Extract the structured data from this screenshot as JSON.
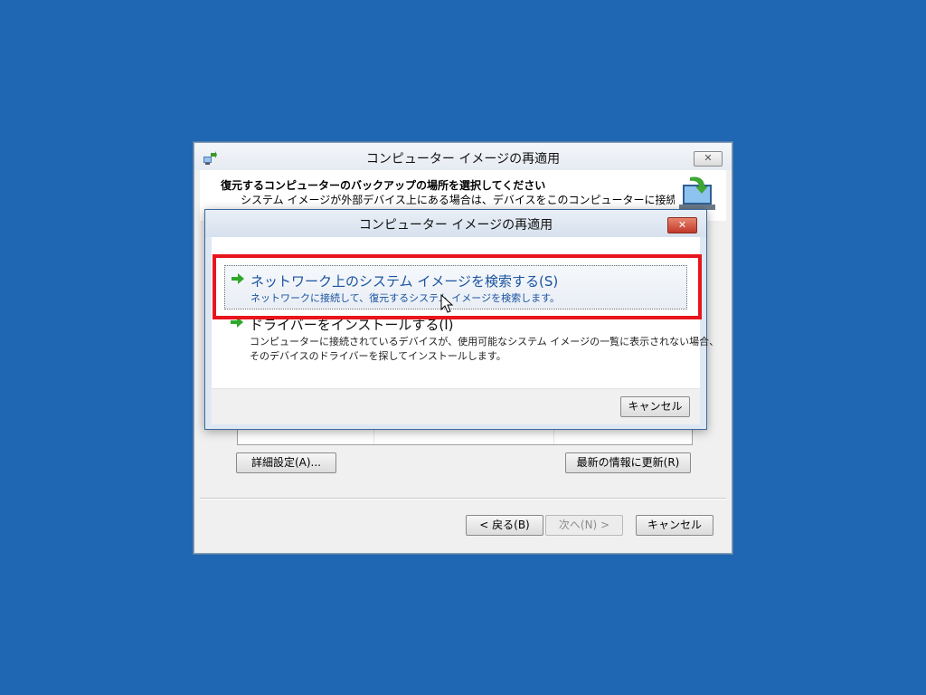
{
  "main_window": {
    "title": "コンピューター イメージの再適用",
    "heading": "復元するコンピューターのバックアップの場所を選択してください",
    "description": "システム イメージが外部デバイス上にある場合は、デバイスをこのコンピューターに接続し、[最新の情報",
    "advanced_button": "詳細設定(A)...",
    "refresh_button": "最新の情報に更新(R)",
    "back_button": "< 戻る(B)",
    "next_button": "次へ(N) >",
    "cancel_button": "キャンセル"
  },
  "dialog": {
    "title": "コンピューター イメージの再適用",
    "options": [
      {
        "title": "ネットワーク上のシステム イメージを検索する(S)",
        "description": "ネットワークに接続して、復元するシステム イメージを検索します。"
      },
      {
        "title": "ドライバーをインストールする(I)",
        "description_line1": "コンピューターに接続されているデバイスが、使用可能なシステム イメージの一覧に表示されない場合、",
        "description_line2": "そのデバイスのドライバーを探してインストールします。"
      }
    ],
    "cancel_button": "キャンセル"
  },
  "colors": {
    "desktop": "#1f66b3",
    "highlight": "#e8151c",
    "link_text": "#1a53a0"
  }
}
